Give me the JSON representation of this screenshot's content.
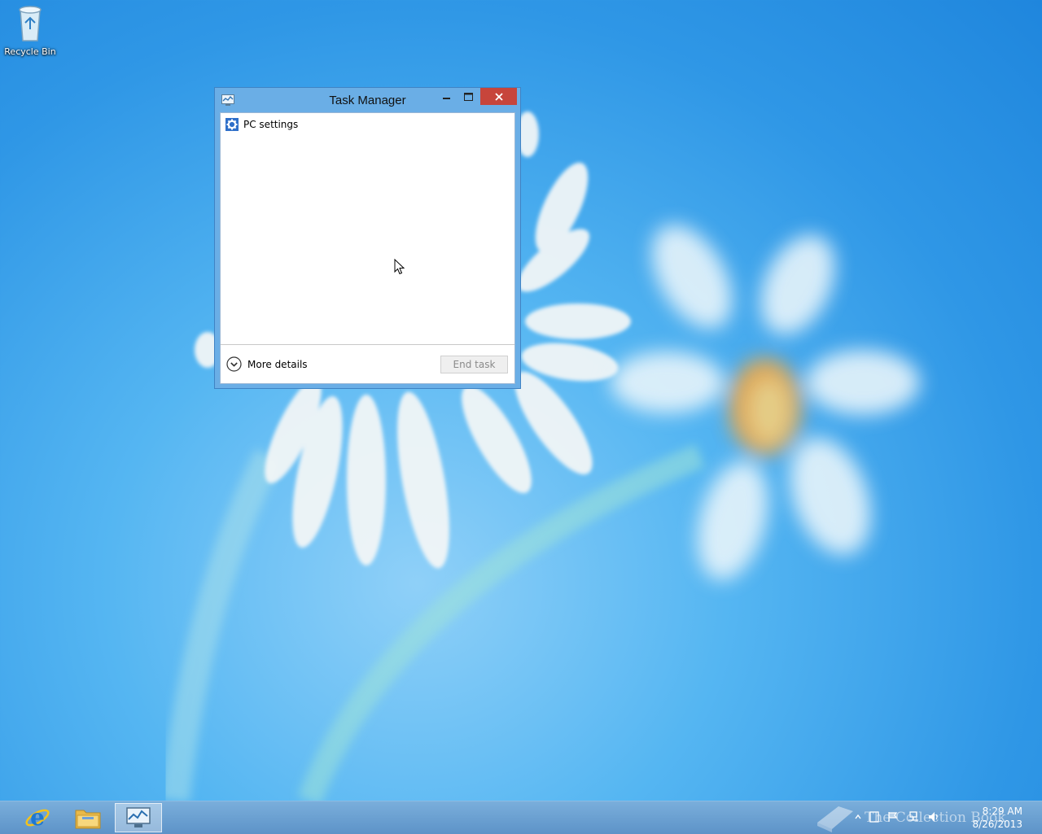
{
  "desktop": {
    "icons": [
      {
        "label": "Recycle Bin",
        "icon": "recycle-bin-icon"
      }
    ]
  },
  "window": {
    "title": "Task Manager",
    "app_icon": "task-manager-icon",
    "controls": {
      "minimize_icon": "minimize-icon",
      "maximize_icon": "maximize-icon",
      "close_icon": "close-icon"
    },
    "items": [
      {
        "label": "PC settings",
        "icon": "gear-icon"
      }
    ],
    "footer": {
      "more_details_label": "More details",
      "more_details_icon": "chevron-down-circle-icon",
      "end_task_label": "End task"
    }
  },
  "taskbar": {
    "pinned": [
      {
        "name": "Internet Explorer",
        "icon": "internet-explorer-icon"
      },
      {
        "name": "File Explorer",
        "icon": "folder-icon"
      },
      {
        "name": "Task Manager",
        "icon": "task-manager-icon",
        "active": true
      }
    ],
    "tray_icons": [
      "chevron-up-icon",
      "page-icon",
      "flag-icon",
      "network-icon",
      "speaker-icon"
    ],
    "clock": {
      "time": "8:29 AM",
      "date": "8/26/2013"
    },
    "watermark": "The Collection Book"
  },
  "colors": {
    "desktop_bg": "#3a9fe9",
    "window_frame": "#6aaee6",
    "close_button": "#c7453b",
    "taskbar": "#6ea2d2"
  }
}
